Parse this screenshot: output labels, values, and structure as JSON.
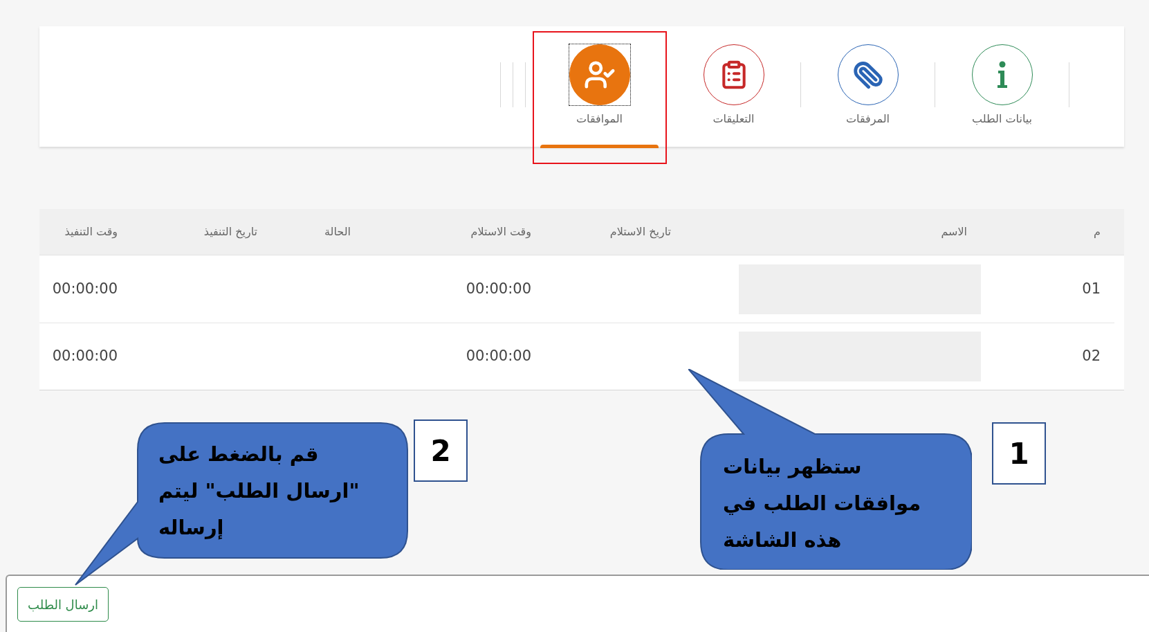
{
  "tabs": [
    {
      "label": "بيانات الطلب",
      "selected": false,
      "highlighted": false,
      "color": "#2e8b57"
    },
    {
      "label": "المرفقات",
      "selected": false,
      "highlighted": false,
      "color": "#2a64b4"
    },
    {
      "label": "التعليقات",
      "selected": false,
      "highlighted": false,
      "color": "#c62828"
    },
    {
      "label": "الموافقات",
      "selected": true,
      "highlighted": true,
      "color": "#e8740f"
    }
  ],
  "table": {
    "columns": [
      "م",
      "الاسم",
      "تاريخ الاستلام",
      "وقت الاستلام",
      "الحالة",
      "تاريخ التنفيذ",
      "وقت التنفيذ"
    ],
    "rows": [
      {
        "number": "01",
        "receive_time": "00:00:00",
        "execute_time": "00:00:00"
      },
      {
        "number": "02",
        "receive_time": "00:00:00",
        "execute_time": "00:00:00"
      }
    ]
  },
  "callouts": [
    {
      "step": "1",
      "lines": [
        "ستظهر بيانات",
        "موافقات الطلب في",
        "هذه الشاشة"
      ]
    },
    {
      "step": "2",
      "lines": [
        "قم بالضغط على",
        "\"ارسال الطلب\" ليتم",
        "إرساله"
      ]
    }
  ],
  "submit_button": "ارسال الطلب"
}
